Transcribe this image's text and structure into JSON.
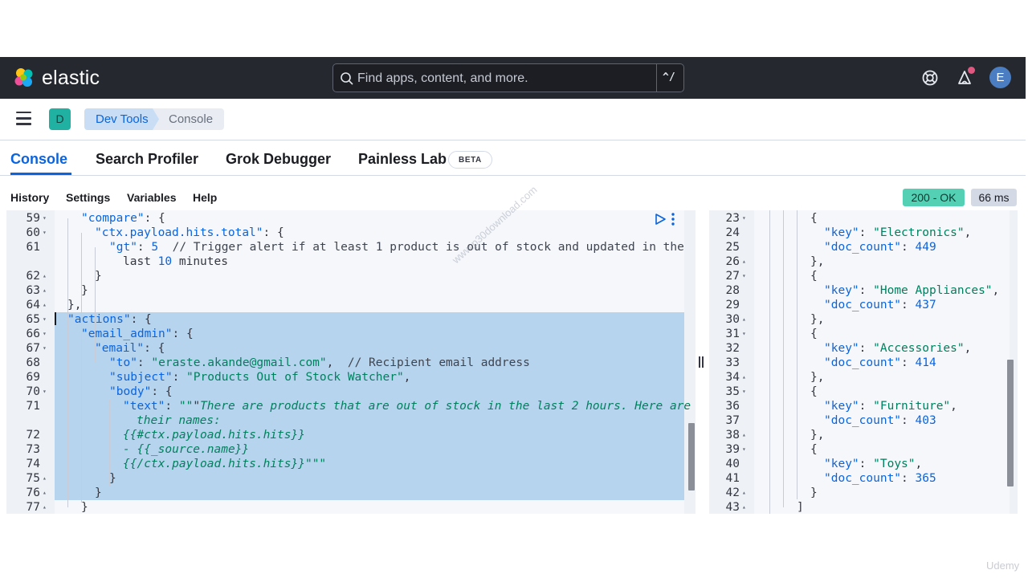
{
  "header": {
    "brand": "elastic",
    "search_placeholder": "Find apps, content, and more.",
    "shortcut": "^/",
    "user_initial": "E",
    "icons": [
      "elastic-logo",
      "search-icon",
      "help-icon",
      "newsfeed-icon",
      "user-avatar"
    ]
  },
  "breadcrumb": {
    "space_initial": "D",
    "items": [
      "Dev Tools",
      "Console"
    ]
  },
  "tabs": {
    "console": "Console",
    "search_profiler": "Search Profiler",
    "grok_debugger": "Grok Debugger",
    "painless_lab": "Painless Lab",
    "beta": "BETA"
  },
  "toolbar": {
    "history": "History",
    "settings": "Settings",
    "variables": "Variables",
    "help": "Help",
    "status": "200 - OK",
    "time": "66 ms",
    "status_color": "#54d1b5"
  },
  "watermark": {
    "diagonal": "www.p30download.com",
    "corner": "Udemy"
  },
  "request_lines": [
    {
      "n": "59",
      "fold": "▾",
      "text": "\"compare\": {"
    },
    {
      "n": "60",
      "fold": "▾",
      "text": "\"ctx.payload.hits.total\": {"
    },
    {
      "n": "61",
      "fold": "",
      "text": "\"gt\": 5  // Trigger alert if at least 1 product is out of stock and updated in the"
    },
    {
      "n": "",
      "fold": "",
      "text": "last 10 minutes"
    },
    {
      "n": "62",
      "fold": "▴",
      "text": "}"
    },
    {
      "n": "63",
      "fold": "▴",
      "text": "}"
    },
    {
      "n": "64",
      "fold": "▴",
      "text": "},"
    },
    {
      "n": "65",
      "fold": "▾",
      "text": "\"actions\": {"
    },
    {
      "n": "66",
      "fold": "▾",
      "text": "\"email_admin\": {"
    },
    {
      "n": "67",
      "fold": "▾",
      "text": "\"email\": {"
    },
    {
      "n": "68",
      "fold": "",
      "text": "\"to\": \"eraste.akande@gmail.com\",  // Recipient email address"
    },
    {
      "n": "69",
      "fold": "",
      "text": "\"subject\": \"Products Out of Stock Watcher\","
    },
    {
      "n": "70",
      "fold": "▾",
      "text": "\"body\": {"
    },
    {
      "n": "71",
      "fold": "",
      "text": "\"text\": \"\"\"There are products that are out of stock in the last 2 hours. Here are"
    },
    {
      "n": "",
      "fold": "",
      "text": "their names:"
    },
    {
      "n": "72",
      "fold": "",
      "text": "{{#ctx.payload.hits.hits}}"
    },
    {
      "n": "73",
      "fold": "",
      "text": "- {{_source.name}}"
    },
    {
      "n": "74",
      "fold": "",
      "text": "{{/ctx.payload.hits.hits}}\"\"\""
    },
    {
      "n": "75",
      "fold": "▴",
      "text": "}"
    },
    {
      "n": "76",
      "fold": "▴",
      "text": "}"
    },
    {
      "n": "77",
      "fold": "▴",
      "text": "}"
    }
  ],
  "response_lines": [
    {
      "n": "23",
      "fold": "▾",
      "text": "{"
    },
    {
      "n": "24",
      "fold": "",
      "text": "\"key\": \"Electronics\","
    },
    {
      "n": "25",
      "fold": "",
      "text": "\"doc_count\": 449"
    },
    {
      "n": "26",
      "fold": "▴",
      "text": "},"
    },
    {
      "n": "27",
      "fold": "▾",
      "text": "{"
    },
    {
      "n": "28",
      "fold": "",
      "text": "\"key\": \"Home Appliances\","
    },
    {
      "n": "29",
      "fold": "",
      "text": "\"doc_count\": 437"
    },
    {
      "n": "30",
      "fold": "▴",
      "text": "},"
    },
    {
      "n": "31",
      "fold": "▾",
      "text": "{"
    },
    {
      "n": "32",
      "fold": "",
      "text": "\"key\": \"Accessories\","
    },
    {
      "n": "33",
      "fold": "",
      "text": "\"doc_count\": 414"
    },
    {
      "n": "34",
      "fold": "▴",
      "text": "},"
    },
    {
      "n": "35",
      "fold": "▾",
      "text": "{"
    },
    {
      "n": "36",
      "fold": "",
      "text": "\"key\": \"Furniture\","
    },
    {
      "n": "37",
      "fold": "",
      "text": "\"doc_count\": 403"
    },
    {
      "n": "38",
      "fold": "▴",
      "text": "},"
    },
    {
      "n": "39",
      "fold": "▾",
      "text": "{"
    },
    {
      "n": "40",
      "fold": "",
      "text": "\"key\": \"Toys\","
    },
    {
      "n": "41",
      "fold": "",
      "text": "\"doc_count\": 365"
    },
    {
      "n": "42",
      "fold": "▴",
      "text": "}"
    },
    {
      "n": "43",
      "fold": "▴",
      "text": "]"
    }
  ]
}
